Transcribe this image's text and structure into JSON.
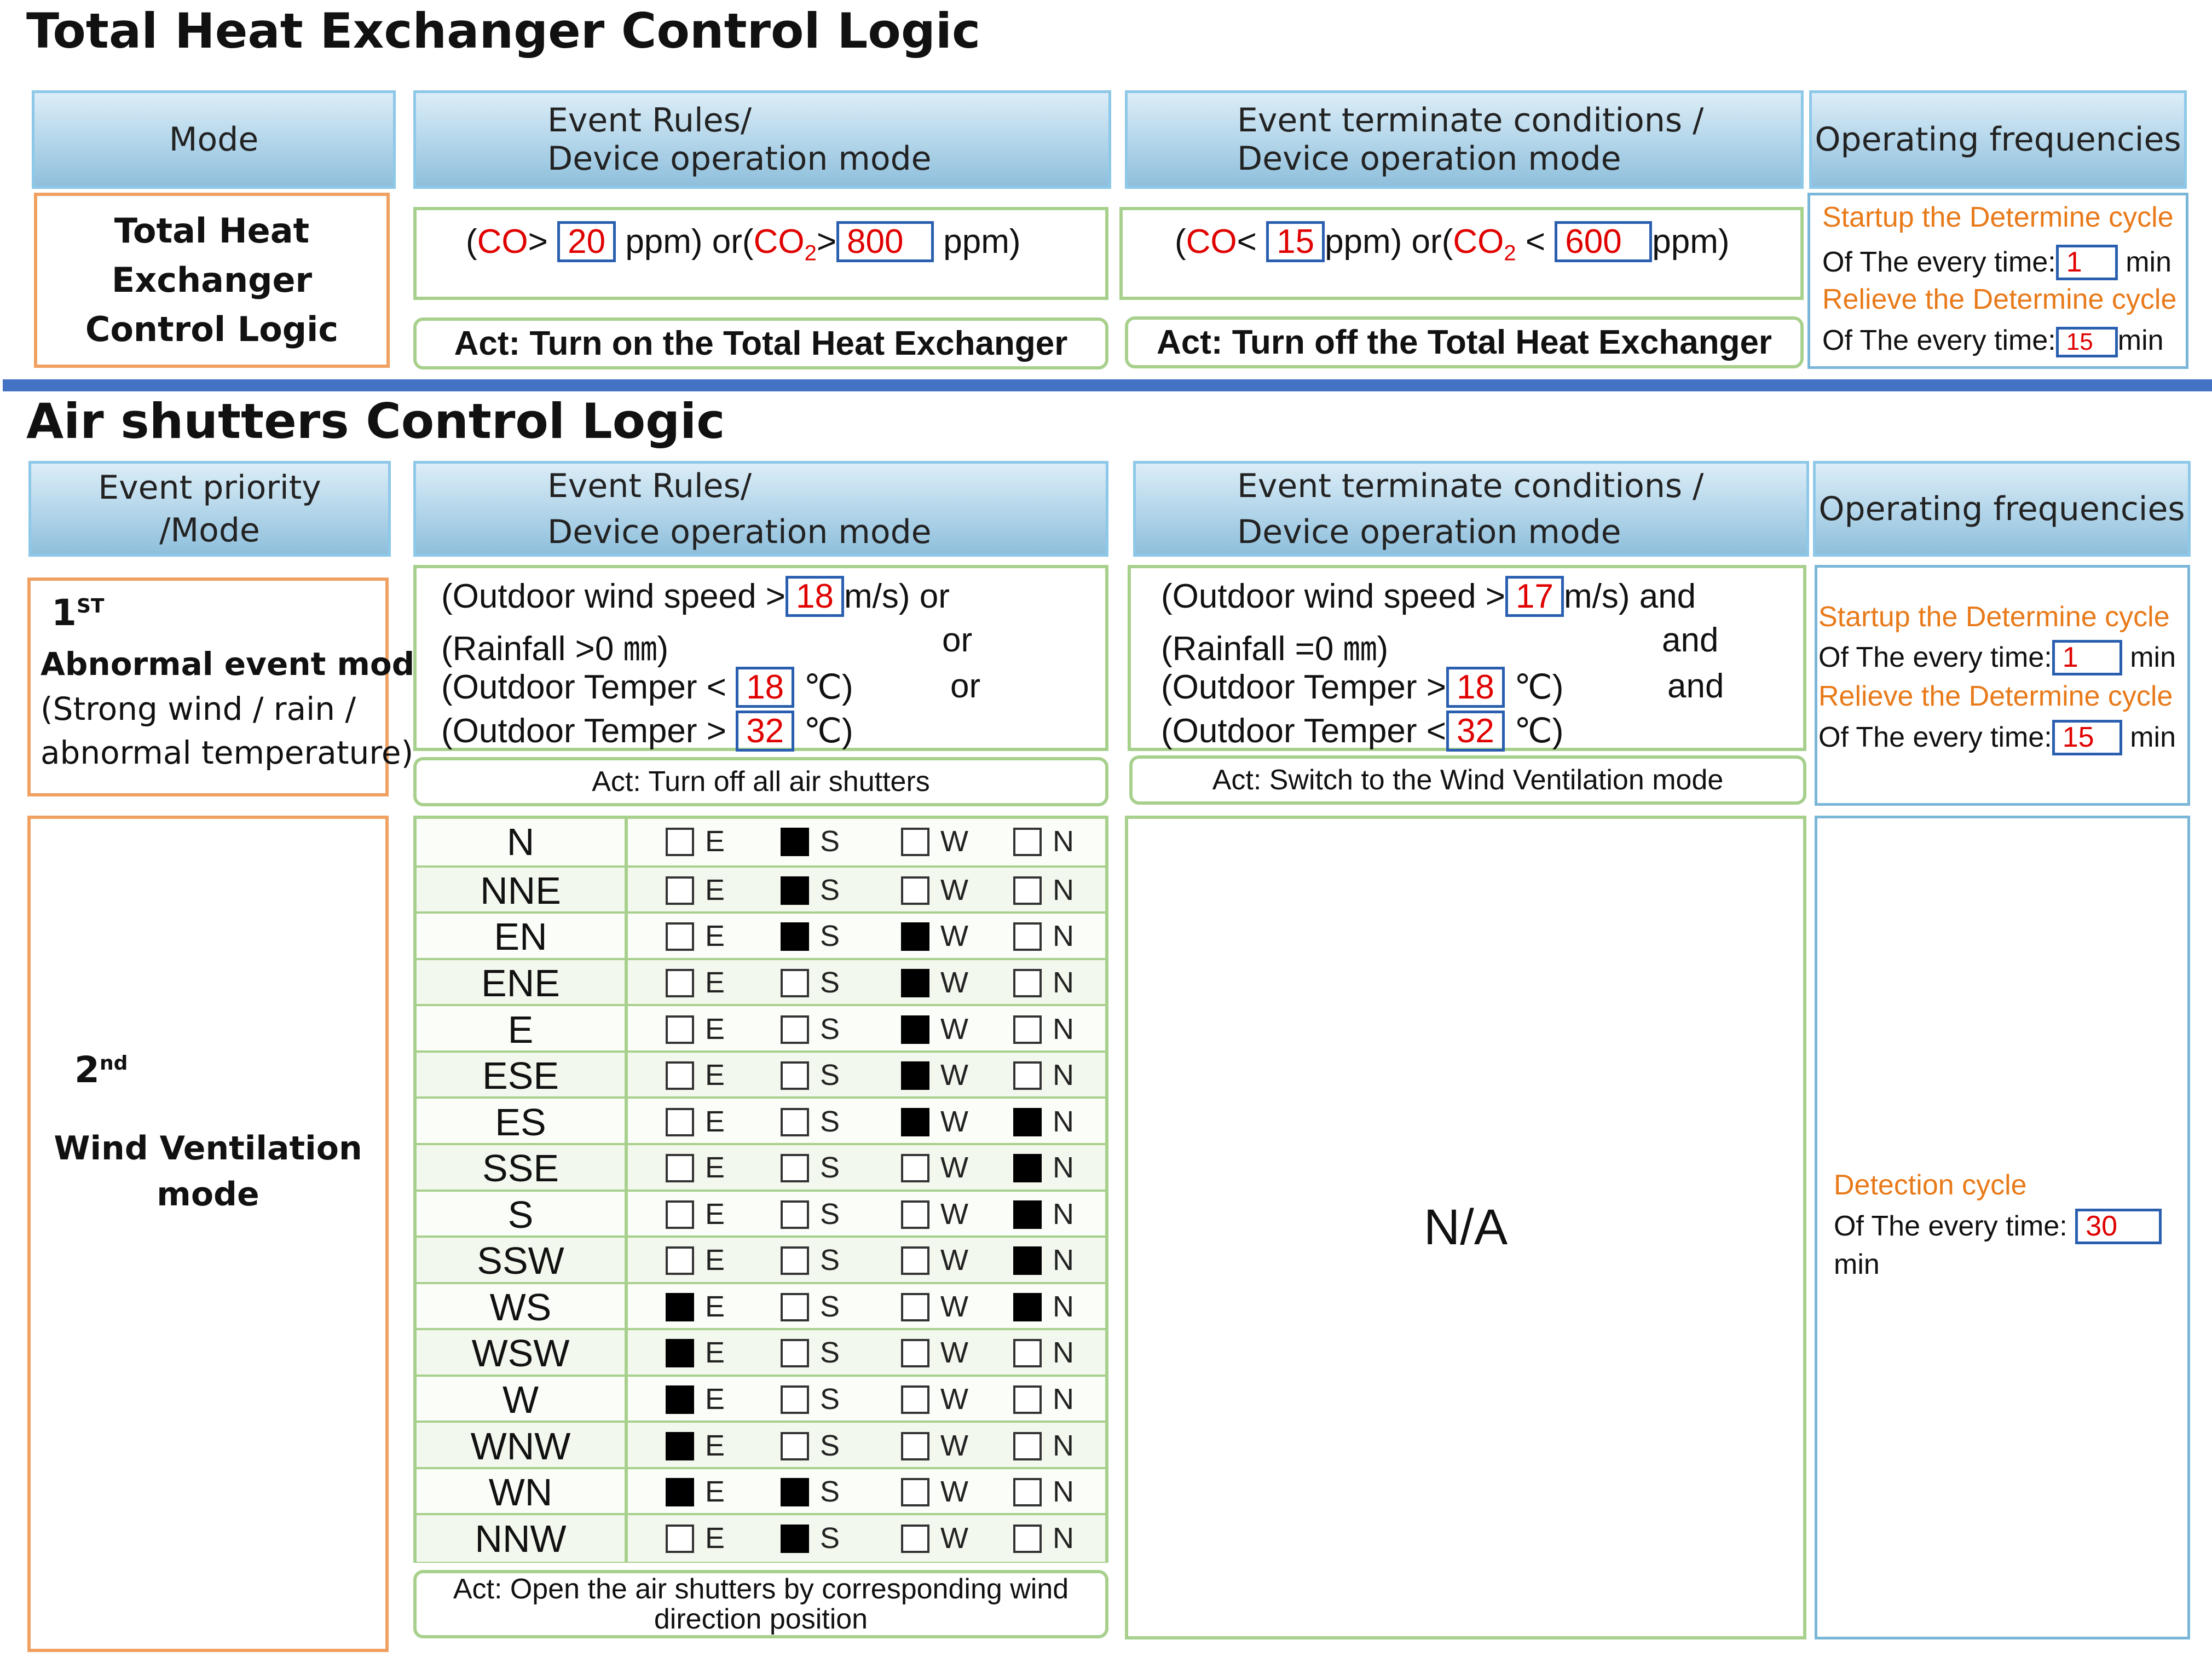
{
  "the": {
    "title": "Total Heat Exchanger Control Logic",
    "headers": {
      "mode": "Mode",
      "rules_1": "Event Rules/",
      "rules_2": "Device operation mode",
      "term_1": "Event terminate  conditions /",
      "term_2": "Device operation mode",
      "freq": "Operating frequencies"
    },
    "mode_label_1": "Total Heat",
    "mode_label_2": "Exchanger",
    "mode_label_3": "Control Logic",
    "rule": {
      "p1": "(",
      "co": "CO",
      "gt": ">",
      "v1": "20",
      "ppm_or": "ppm) or(",
      "co2": "CO",
      "sub2": "2",
      "gt2": ">",
      "v2": "800",
      "ppm": "ppm)"
    },
    "term": {
      "p1": "(",
      "co": "CO",
      "lt": "<",
      "v1": "15",
      "ppm_or": "ppm) or(",
      "co2": "CO",
      "sub2": "2",
      "lt2": "<",
      "v2": "600",
      "ppm": "ppm)"
    },
    "act_on": "Act: Turn on the Total Heat Exchanger",
    "act_off": "Act: Turn off the Total Heat Exchanger",
    "freq": {
      "startup": "Startup the Determine cycle",
      "every": "Of The every time:",
      "startup_val": "1",
      "unit": "min",
      "relieve": "Relieve the Determine cycle",
      "relieve_val": "15"
    }
  },
  "air": {
    "title": "Air shutters Control Logic",
    "headers": {
      "mode_1": "Event priority",
      "mode_2": "/Mode",
      "rules_1": "Event Rules/",
      "rules_2": "Device operation mode",
      "term_1": "Event terminate  conditions /",
      "term_2": "Device operation mode",
      "freq": "Operating frequencies"
    },
    "mode1": {
      "num": "1",
      "sup": "ST",
      "name": "Abnormal event mode",
      "desc_1": "(Strong wind / rain /",
      "desc_2": "abnormal temperature)"
    },
    "rules": {
      "l1a": "(Outdoor wind speed >",
      "l1v": "18",
      "l1b": "m/s) or",
      "l2a": "(Rainfall >0 ㎜)",
      "l2b": "or",
      "l3a": "(Outdoor Temper <",
      "l3v": "18",
      "l3b": "℃)",
      "l3c": "or",
      "l4a": "(Outdoor Temper >",
      "l4v": "32",
      "l4b": "℃)"
    },
    "terms": {
      "l1a": "(Outdoor wind speed >",
      "l1v": "17",
      "l1b": "m/s) and",
      "l2a": "(Rainfall =0 ㎜)",
      "l2b": "and",
      "l3a": "(Outdoor Temper >",
      "l3v": "18",
      "l3b": "℃)",
      "l3c": "and",
      "l4a": "(Outdoor Temper <",
      "l4v": "32",
      "l4b": "℃)"
    },
    "act_off": "Act: Turn off all air shutters",
    "act_switch": "Act: Switch to the Wind Ventilation mode",
    "freq1": {
      "startup": "Startup the Determine cycle",
      "every": "Of The every time:",
      "startup_val": "1",
      "unit": "min",
      "relieve": "Relieve the Determine cycle",
      "relieve_val": "15"
    },
    "mode2": {
      "num": "2",
      "sup": "nd",
      "name_1": "Wind Ventilation",
      "name_2": "mode"
    },
    "checkbox_labels": [
      "E",
      "S",
      "W",
      "N"
    ],
    "wind_rows": [
      {
        "dir": "N",
        "checks": [
          false,
          true,
          false,
          false
        ]
      },
      {
        "dir": "NNE",
        "checks": [
          false,
          true,
          false,
          false
        ]
      },
      {
        "dir": "EN",
        "checks": [
          false,
          true,
          true,
          false
        ]
      },
      {
        "dir": "ENE",
        "checks": [
          false,
          false,
          true,
          false
        ]
      },
      {
        "dir": "E",
        "checks": [
          false,
          false,
          true,
          false
        ]
      },
      {
        "dir": "ESE",
        "checks": [
          false,
          false,
          true,
          false
        ]
      },
      {
        "dir": "ES",
        "checks": [
          false,
          false,
          true,
          true
        ]
      },
      {
        "dir": "SSE",
        "checks": [
          false,
          false,
          false,
          true
        ]
      },
      {
        "dir": "S",
        "checks": [
          false,
          false,
          false,
          true
        ]
      },
      {
        "dir": "SSW",
        "checks": [
          false,
          false,
          false,
          true
        ]
      },
      {
        "dir": "WS",
        "checks": [
          true,
          false,
          false,
          true
        ]
      },
      {
        "dir": "WSW",
        "checks": [
          true,
          false,
          false,
          false
        ]
      },
      {
        "dir": "W",
        "checks": [
          true,
          false,
          false,
          false
        ]
      },
      {
        "dir": "WNW",
        "checks": [
          true,
          false,
          false,
          false
        ]
      },
      {
        "dir": "WN",
        "checks": [
          true,
          true,
          false,
          false
        ]
      },
      {
        "dir": "NNW",
        "checks": [
          false,
          true,
          false,
          false
        ]
      }
    ],
    "act_open_1": "Act: Open the air shutters by corresponding wind",
    "act_open_2": "direction position",
    "na": "N/A",
    "detect": {
      "label": "Detection cycle",
      "every": "Of The every time:",
      "val": "30",
      "unit": "min"
    }
  },
  "colors": {
    "header_gradient_top": "#dcedf7",
    "header_gradient_bottom": "#8fbfdc",
    "orange_border": "#f0a060",
    "green_border": "#a8d08d",
    "blue_border": "#7ab6d8",
    "divider": "#4472c4",
    "value_red": "#e00000",
    "orange_text": "#e87a1a"
  }
}
